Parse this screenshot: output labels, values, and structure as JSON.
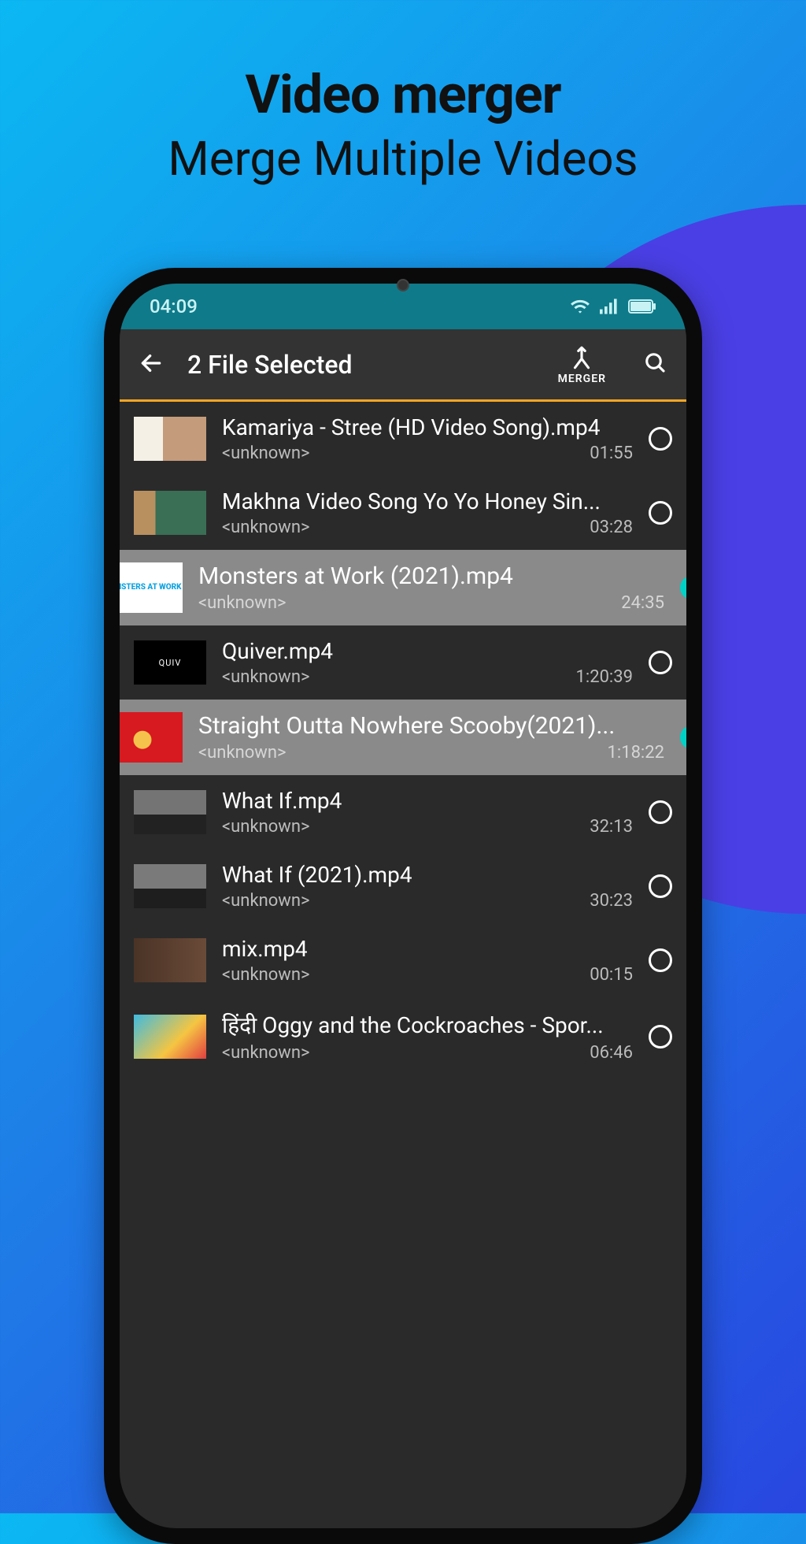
{
  "hero": {
    "title": "Video merger",
    "subtitle": "Merge Multiple Videos"
  },
  "statusbar": {
    "time": "04:09"
  },
  "topbar": {
    "title": "2 File Selected",
    "merger_label": "MERGER"
  },
  "videos": [
    {
      "title": "Kamariya - Stree (HD Video Song).mp4",
      "author": "<unknown>",
      "duration": "01:55",
      "selected": false,
      "thumb": "th1"
    },
    {
      "title": "Makhna Video Song Yo Yo Honey Sin...",
      "author": "<unknown>",
      "duration": "03:28",
      "selected": false,
      "thumb": "th2"
    },
    {
      "title": "Monsters at Work (2021).mp4",
      "author": "<unknown>",
      "duration": "24:35",
      "selected": true,
      "thumb": "th3"
    },
    {
      "title": "Quiver.mp4",
      "author": "<unknown>",
      "duration": "1:20:39",
      "selected": false,
      "thumb": "th4"
    },
    {
      "title": "Straight Outta Nowhere Scooby(2021)...",
      "author": "<unknown>",
      "duration": "1:18:22",
      "selected": true,
      "thumb": "th5"
    },
    {
      "title": "What If.mp4",
      "author": "<unknown>",
      "duration": "32:13",
      "selected": false,
      "thumb": "th6"
    },
    {
      "title": "What If (2021).mp4",
      "author": "<unknown>",
      "duration": "30:23",
      "selected": false,
      "thumb": "th7"
    },
    {
      "title": "mix.mp4",
      "author": "<unknown>",
      "duration": "00:15",
      "selected": false,
      "thumb": "th8"
    },
    {
      "title": "हिंदी Oggy and the Cockroaches - Spor...",
      "author": "<unknown>",
      "duration": "06:46",
      "selected": false,
      "thumb": "th9"
    }
  ],
  "thumb_text": {
    "th3": "MONSTERS AT WORK",
    "th4": "QUIV"
  }
}
